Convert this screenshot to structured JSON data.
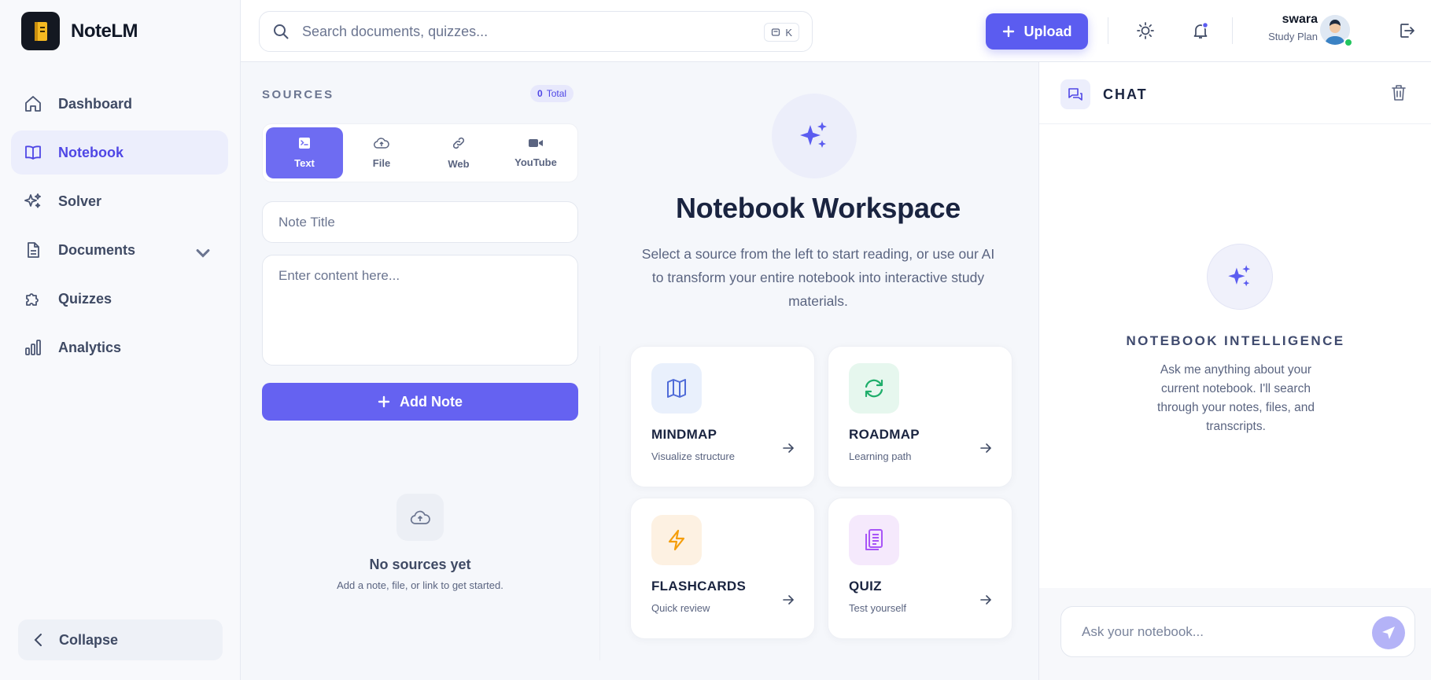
{
  "app": {
    "name": "NoteLM"
  },
  "sidebar": {
    "items": [
      {
        "label": "Dashboard",
        "icon": "home-icon"
      },
      {
        "label": "Notebook",
        "icon": "book-icon",
        "active": true
      },
      {
        "label": "Solver",
        "icon": "sparkles-icon"
      },
      {
        "label": "Documents",
        "icon": "document-icon",
        "has_submenu": true
      },
      {
        "label": "Quizzes",
        "icon": "puzzle-icon"
      },
      {
        "label": "Analytics",
        "icon": "bar-chart-icon"
      }
    ],
    "collapse_label": "Collapse"
  },
  "topbar": {
    "search_placeholder": "Search documents, quizzes...",
    "shortcut_key": "K",
    "upload_label": "Upload",
    "user_name": "swara",
    "user_plan": "Study Plan"
  },
  "sources": {
    "title": "SOURCES",
    "total_count": "0",
    "total_label": "Total",
    "tabs": [
      {
        "label": "Text",
        "icon": "terminal-icon",
        "active": true
      },
      {
        "label": "File",
        "icon": "cloud-upload-icon"
      },
      {
        "label": "Web",
        "icon": "link-icon"
      },
      {
        "label": "YouTube",
        "icon": "video-icon"
      }
    ],
    "note_title_placeholder": "Note Title",
    "content_placeholder": "Enter content here...",
    "add_note_label": "Add Note",
    "empty_title": "No sources yet",
    "empty_subtitle": "Add a note, file, or link to get started."
  },
  "workspace": {
    "title": "Notebook Workspace",
    "description": "Select a source from the left to start reading, or use our AI to transform your entire notebook into interactive study materials.",
    "cards": [
      {
        "title": "MINDMAP",
        "subtitle": "Visualize structure",
        "icon": "map-icon",
        "color": "#4f6bd8",
        "bg": "#e9f0fc"
      },
      {
        "title": "ROADMAP",
        "subtitle": "Learning path",
        "icon": "refresh-icon",
        "color": "#1fae6b",
        "bg": "#e6f7ee"
      },
      {
        "title": "FLASHCARDS",
        "subtitle": "Quick review",
        "icon": "lightning-icon",
        "color": "#f59e0b",
        "bg": "#fdf1e2"
      },
      {
        "title": "QUIZ",
        "subtitle": "Test yourself",
        "icon": "clipboard-icon",
        "color": "#a855f7",
        "bg": "#f5e9fc"
      }
    ]
  },
  "chat": {
    "title": "CHAT",
    "intel_title": "NOTEBOOK INTELLIGENCE",
    "intel_desc": "Ask me anything about your current notebook. I'll search through your notes, files, and transcripts.",
    "input_placeholder": "Ask your notebook..."
  },
  "colors": {
    "accent": "#5b5cf0",
    "active_bg": "#eceefc"
  }
}
